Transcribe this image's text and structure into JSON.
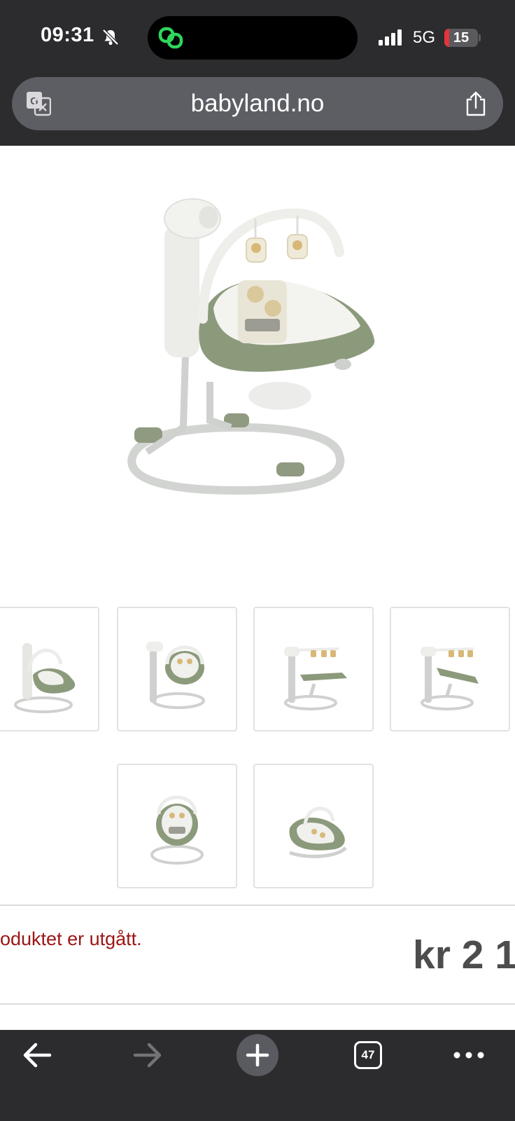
{
  "status_bar": {
    "time": "09:31",
    "network": "5G",
    "battery_level": "15",
    "battery_fraction": 0.15,
    "colors": {
      "battery_low": "#e5343a",
      "island_app": "#2fd65c"
    },
    "icons": [
      "bell-slash-icon",
      "island-link-icon",
      "signal-bars-icon"
    ]
  },
  "browser": {
    "url": "babyland.no",
    "tab_count": "47",
    "icons": [
      "translate-icon",
      "share-icon",
      "back-arrow-icon",
      "forward-arrow-icon",
      "plus-icon",
      "tabs-icon",
      "more-dots-icon"
    ]
  },
  "product": {
    "notice": "oduktet er utgått.",
    "price": "kr 2 1",
    "colors": {
      "notice": "#9b1515",
      "price": "#4d4d4d",
      "seat": "#8c9a7c"
    }
  }
}
